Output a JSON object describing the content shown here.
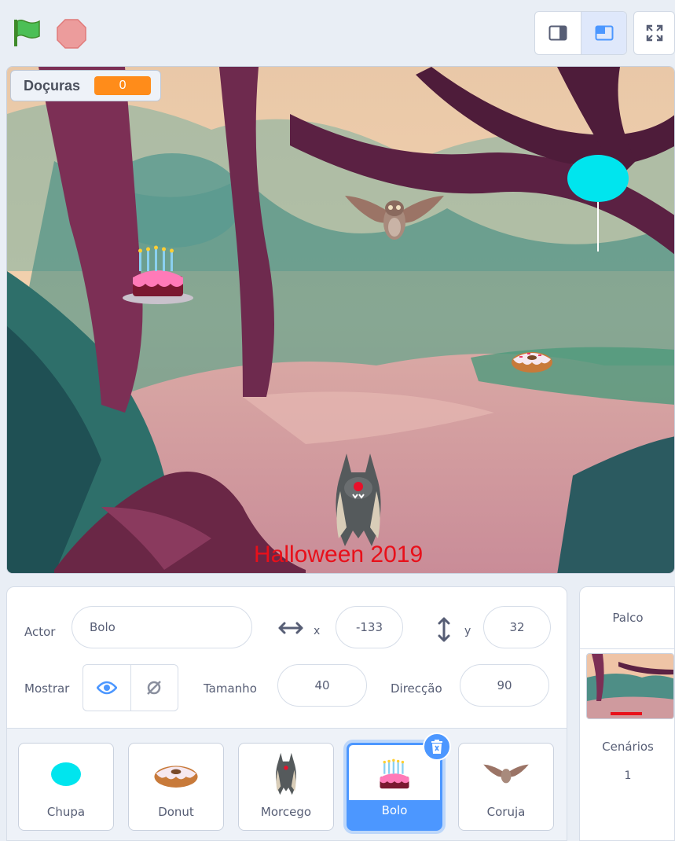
{
  "toolbar": {
    "flag_icon": "green-flag-icon",
    "stop_icon": "stop-sign-icon",
    "modes": [
      "small-stage-icon",
      "normal-stage-icon"
    ],
    "fullscreen_icon": "fullscreen-icon"
  },
  "stage": {
    "monitor": {
      "label": "Doçuras",
      "value": "0"
    },
    "caption": "Halloween 2019"
  },
  "sprite_info": {
    "sprite_label": "Actor",
    "sprite_name": "Bolo",
    "x_label": "x",
    "x_value": "-133",
    "y_label": "y",
    "y_value": "32",
    "show_label": "Mostrar",
    "size_label": "Tamanho",
    "size_value": "40",
    "direction_label": "Direcção",
    "direction_value": "90"
  },
  "sprites": [
    {
      "name": "Chupa"
    },
    {
      "name": "Donut"
    },
    {
      "name": "Morcego"
    },
    {
      "name": "Bolo",
      "selected": true
    },
    {
      "name": "Coruja"
    }
  ],
  "stage_panel": {
    "title": "Palco",
    "backdrops_label": "Cenários",
    "backdrops_count": "1"
  },
  "colors": {
    "accent": "#4c97ff",
    "monitor_value": "#ff8c1a",
    "caption": "#e8101a",
    "balloon": "#00e5ee"
  }
}
